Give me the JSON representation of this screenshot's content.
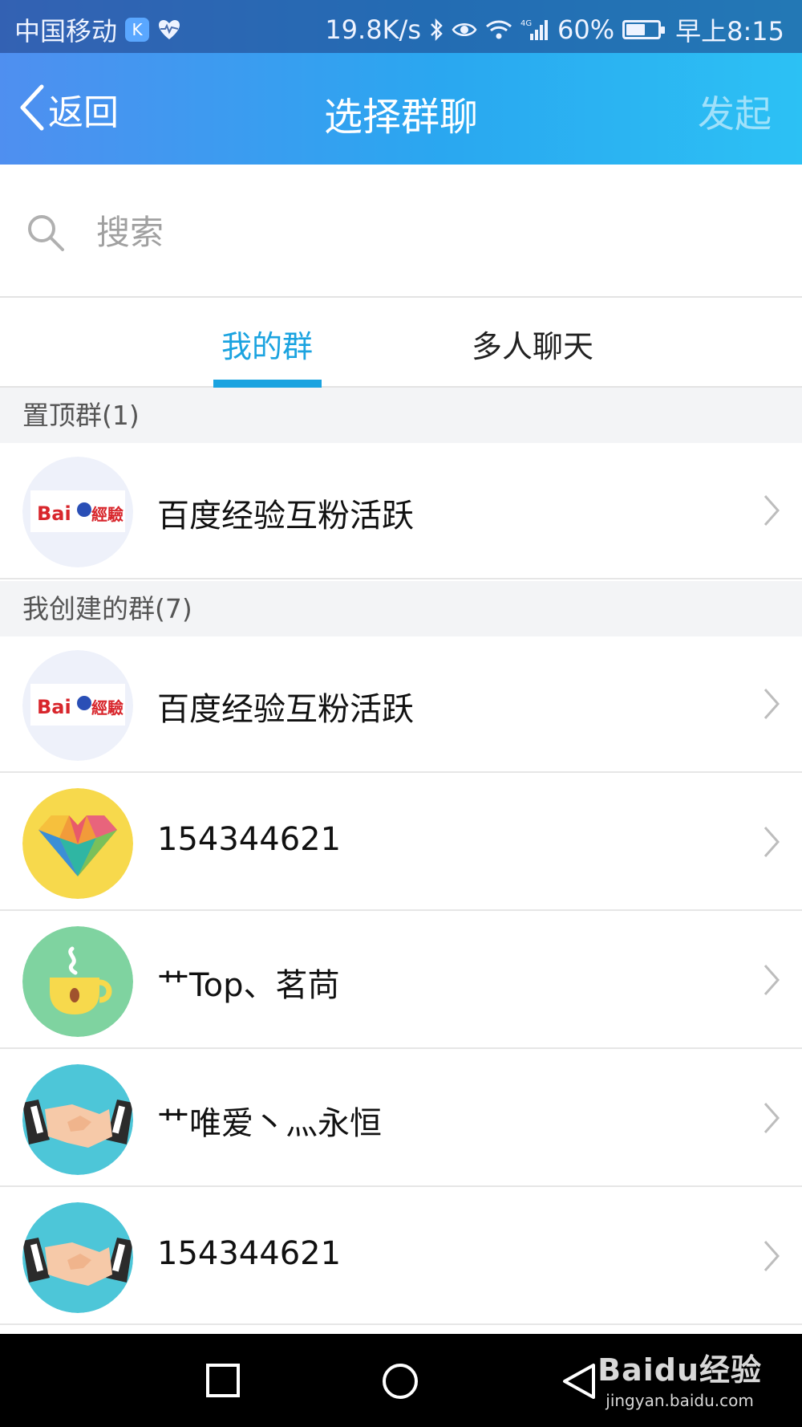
{
  "status_bar": {
    "carrier": "中国移动",
    "badge": "K",
    "net_speed": "19.8K/s",
    "network_type": "4G",
    "battery": "60%",
    "battery_level": 0.6,
    "time": "早上8:15"
  },
  "navbar": {
    "back_label": "返回",
    "title": "选择群聊",
    "action_label": "发起"
  },
  "search": {
    "placeholder": "搜索"
  },
  "tabs": [
    {
      "label": "我的群",
      "active": true
    },
    {
      "label": "多人聊天",
      "active": false
    }
  ],
  "sections": {
    "pinned": {
      "title": "置顶群(1)"
    },
    "created": {
      "title": "我创建的群(7)"
    }
  },
  "groups": {
    "pinned": [
      {
        "name": "百度经验互粉活跃",
        "avatar": "baidu-jingyan-logo",
        "logo_text": "Bai經驗"
      }
    ],
    "created": [
      {
        "name": "百度经验互粉活跃",
        "avatar": "baidu-jingyan-logo"
      },
      {
        "name": "154344621",
        "avatar": "heart-icon"
      },
      {
        "name": "艹Top、茗苘",
        "avatar": "coffee-cup-icon"
      },
      {
        "name": "艹唯爱丶灬永恒",
        "avatar": "handshake-icon"
      },
      {
        "name": "154344621",
        "avatar": "handshake-icon"
      }
    ]
  },
  "bottom_nav": {
    "buttons": [
      "square-recent-icon",
      "circle-home-icon",
      "triangle-back-icon"
    ]
  },
  "watermark": {
    "logo": "Baidu经验",
    "url": "jingyan.baidu.com"
  },
  "colors": {
    "header_start": "#4f8ff0",
    "header_end": "#2cc1f4",
    "tab_active": "#1aa3e0",
    "section_bg": "#f3f4f6"
  }
}
